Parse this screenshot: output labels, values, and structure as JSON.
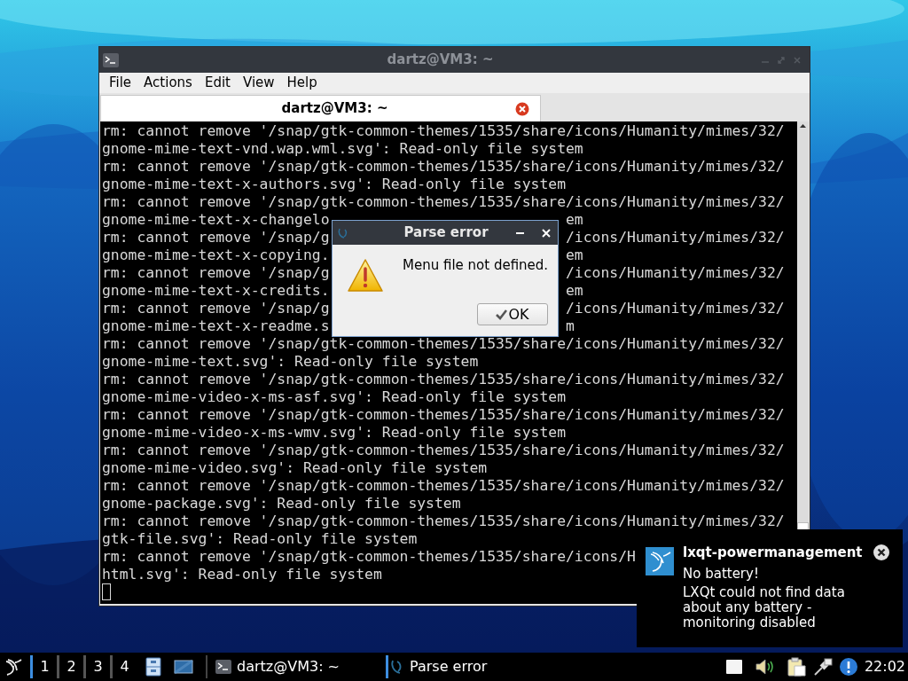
{
  "terminal_window": {
    "title": "dartz@VM3: ~",
    "menu": [
      "File",
      "Actions",
      "Edit",
      "View",
      "Help"
    ],
    "tabs": [
      {
        "label": "dartz@VM3: ~",
        "selected": true
      }
    ],
    "lines": [
      {
        "text": "rm: cannot remove '/snap/gtk-common-themes/1535/share/icons/Humanity/mimes/32/"
      },
      {
        "text": "gnome-mime-text-vnd.wap.wml.svg': Read-only file system"
      },
      {
        "text": "rm: cannot remove '/snap/gtk-common-themes/1535/share/icons/Humanity/mimes/32/"
      },
      {
        "text": "gnome-mime-text-x-authors.svg': Read-only file system"
      },
      {
        "text": "rm: cannot remove '/snap/gtk-common-themes/1535/share/icons/Humanity/mimes/32/"
      },
      {
        "left": "gnome-mime-text-x-changelo",
        "right": "em"
      },
      {
        "left": "rm: cannot remove '/snap/g",
        "right": "/icons/Humanity/mimes/32/"
      },
      {
        "left": "gnome-mime-text-x-copying.",
        "right": "em"
      },
      {
        "left": "rm: cannot remove '/snap/g",
        "right": "/icons/Humanity/mimes/32/"
      },
      {
        "left": "gnome-mime-text-x-credits.",
        "right": "em"
      },
      {
        "left": "rm: cannot remove '/snap/g",
        "right": "/icons/Humanity/mimes/32/"
      },
      {
        "left": "gnome-mime-text-x-readme.s",
        "right": "m"
      },
      {
        "text": "rm: cannot remove '/snap/gtk-common-themes/1535/share/icons/Humanity/mimes/32/"
      },
      {
        "text": "gnome-mime-text.svg': Read-only file system"
      },
      {
        "text": "rm: cannot remove '/snap/gtk-common-themes/1535/share/icons/Humanity/mimes/32/"
      },
      {
        "text": "gnome-mime-video-x-ms-asf.svg': Read-only file system"
      },
      {
        "text": "rm: cannot remove '/snap/gtk-common-themes/1535/share/icons/Humanity/mimes/32/"
      },
      {
        "text": "gnome-mime-video-x-ms-wmv.svg': Read-only file system"
      },
      {
        "text": "rm: cannot remove '/snap/gtk-common-themes/1535/share/icons/Humanity/mimes/32/"
      },
      {
        "text": "gnome-mime-video.svg': Read-only file system"
      },
      {
        "text": "rm: cannot remove '/snap/gtk-common-themes/1535/share/icons/Humanity/mimes/32/"
      },
      {
        "text": "gnome-package.svg': Read-only file system"
      },
      {
        "text": "rm: cannot remove '/snap/gtk-common-themes/1535/share/icons/Humanity/mimes/32/"
      },
      {
        "text": "gtk-file.svg': Read-only file system"
      },
      {
        "text": "rm: cannot remove '/snap/gtk-common-themes/1535/share/icons/H"
      },
      {
        "text": "html.svg': Read-only file system"
      }
    ]
  },
  "dialog": {
    "title": "Parse error",
    "message": "Menu file not defined.",
    "button": "OK"
  },
  "notification": {
    "title": "lxqt-powermanagement",
    "summary": "No battery!",
    "body": "LXQt could not find data about any battery - monitoring disabled"
  },
  "taskbar": {
    "desktops": [
      {
        "label": "1",
        "selected": true
      },
      {
        "label": "2",
        "selected": false
      },
      {
        "label": "3",
        "selected": false
      },
      {
        "label": "4",
        "selected": false
      }
    ],
    "tasks": [
      {
        "kind": "terminal",
        "label": "dartz@VM3: ~",
        "selected": false
      },
      {
        "kind": "dialog",
        "label": "Parse error",
        "selected": true
      }
    ],
    "clock": "22:02"
  }
}
